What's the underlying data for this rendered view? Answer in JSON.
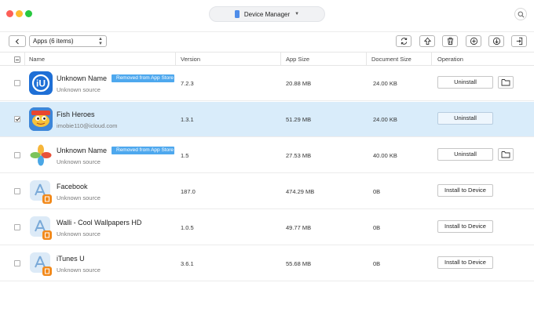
{
  "window": {
    "device_selector": "Device Manager",
    "icons": {
      "search": "search-icon",
      "device": "phone-icon"
    }
  },
  "toolbar": {
    "category_select": "Apps (6 items)",
    "icons": [
      "back-icon",
      "refresh-icon",
      "upload-icon",
      "trash-icon",
      "add-icon",
      "download-icon",
      "export-icon"
    ]
  },
  "table": {
    "columns": {
      "name": "Name",
      "version": "Version",
      "app_size": "App Size",
      "doc_size": "Document Size",
      "operation": "Operation"
    },
    "rows": [
      {
        "name": "Unknown Name",
        "subtitle": "Unknown source",
        "badge": "Removed from App Store",
        "version": "7.2.3",
        "app_size": "20.88 MB",
        "doc_size": "24.00 KB",
        "action": "Uninstall",
        "has_folder": true,
        "checked": false,
        "selected": false,
        "icon": "iu-app-icon"
      },
      {
        "name": "Fish Heroes",
        "subtitle": "imobie110@icloud.com",
        "badge": "",
        "version": "1.3.1",
        "app_size": "51.29 MB",
        "doc_size": "24.00 KB",
        "action": "Uninstall",
        "has_folder": false,
        "checked": true,
        "selected": true,
        "icon": "fish-heroes-app-icon"
      },
      {
        "name": "Unknown Name",
        "subtitle": "Unknown source",
        "badge": "Removed from App Store",
        "version": "1.5",
        "app_size": "27.53 MB",
        "doc_size": "40.00 KB",
        "action": "Uninstall",
        "has_folder": true,
        "checked": false,
        "selected": false,
        "icon": "pinwheel-app-icon"
      },
      {
        "name": "Facebook",
        "subtitle": "Unknown source",
        "badge": "",
        "version": "187.0",
        "app_size": "474.29 MB",
        "doc_size": "0B",
        "action": "Install to Device",
        "has_folder": false,
        "checked": false,
        "selected": false,
        "icon": "app-store-placeholder-icon"
      },
      {
        "name": "Walli - Cool Wallpapers HD",
        "subtitle": "Unknown source",
        "badge": "",
        "version": "1.0.5",
        "app_size": "49.77 MB",
        "doc_size": "0B",
        "action": "Install to Device",
        "has_folder": false,
        "checked": false,
        "selected": false,
        "icon": "app-store-placeholder-icon"
      },
      {
        "name": "iTunes U",
        "subtitle": "Unknown source",
        "badge": "",
        "version": "3.6.1",
        "app_size": "55.68 MB",
        "doc_size": "0B",
        "action": "Install to Device",
        "has_folder": false,
        "checked": false,
        "selected": false,
        "icon": "app-store-placeholder-icon"
      }
    ]
  },
  "colors": {
    "selected_row": "#d9ecfa",
    "badge": "#4ea8ee",
    "accent_orange": "#f28a1c"
  }
}
